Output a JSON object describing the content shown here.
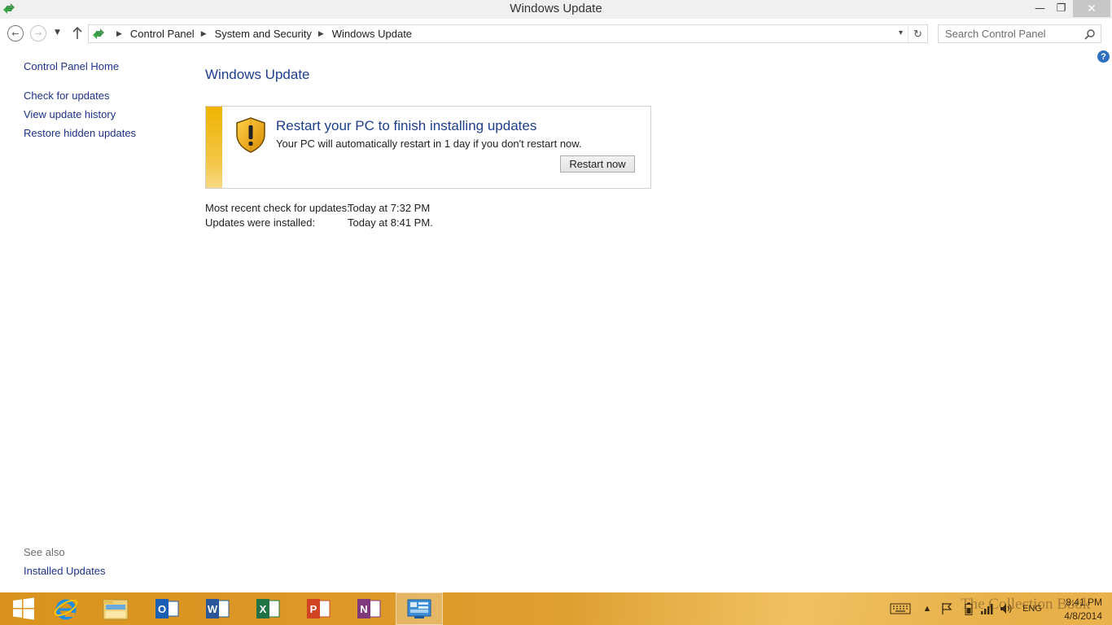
{
  "window": {
    "title": "Windows Update",
    "minimize_glyph": "—",
    "restore_glyph": "❐",
    "close_glyph": "✕"
  },
  "nav": {
    "back_icon": "back-arrow-icon",
    "forward_icon": "forward-arrow-icon",
    "recent_icon": "chevron-down-icon",
    "up_icon": "up-arrow-icon"
  },
  "address": {
    "breadcrumbs": [
      "Control Panel",
      "System and Security",
      "Windows Update"
    ]
  },
  "search": {
    "placeholder": "Search Control Panel"
  },
  "sidebar": {
    "home": "Control Panel Home",
    "items": [
      "Check for updates",
      "View update history",
      "Restore hidden updates"
    ],
    "see_also_label": "See also",
    "see_also_items": [
      "Installed Updates"
    ]
  },
  "main": {
    "title": "Windows Update",
    "notice": {
      "heading": "Restart your PC to finish installing updates",
      "body": "Your PC will automatically restart in 1 day if you don't restart now.",
      "button": "Restart now",
      "accent_color": "#f0b400"
    },
    "status": [
      {
        "label": "Most recent check for updates:",
        "value": "Today at 7:32 PM"
      },
      {
        "label": "Updates were installed:",
        "value": "Today at 8:41 PM."
      }
    ]
  },
  "taskbar": {
    "apps": [
      "start",
      "internet-explorer",
      "file-explorer",
      "outlook",
      "word",
      "excel",
      "powerpoint",
      "onenote",
      "control-panel"
    ],
    "language": "ENG",
    "time": "8:41 PM",
    "date": "4/8/2014",
    "watermark": "The Collection Book",
    "background_color": "#d9931e"
  }
}
